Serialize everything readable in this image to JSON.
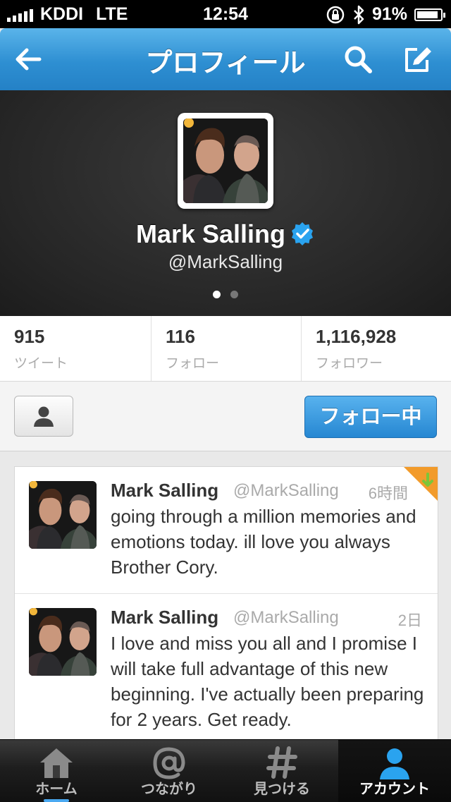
{
  "status_bar": {
    "carrier": "KDDI",
    "network": "LTE",
    "time": "12:54",
    "battery": "91%",
    "battery_level": 0.91
  },
  "navbar": {
    "title": "プロフィール",
    "back_icon": "back-arrow-icon",
    "search_icon": "search-icon",
    "compose_icon": "compose-icon"
  },
  "profile": {
    "name": "Mark Salling",
    "handle": "@MarkSalling",
    "verified": true,
    "page_count": 2,
    "current_page": 1
  },
  "stats": [
    {
      "value": "915",
      "label": "ツイート"
    },
    {
      "value": "116",
      "label": "フォロー"
    },
    {
      "value": "1,116,928",
      "label": "フォロワー"
    }
  ],
  "actions": {
    "follow_label": "フォロー中",
    "person_icon": "person-icon"
  },
  "tweets": [
    {
      "author": "Mark Salling",
      "username": "@MarkSalling",
      "time": "6時間",
      "text": "going through a million memories and emotions today. ill love you always Brother Cory."
    },
    {
      "author": "Mark Salling",
      "username": "@MarkSalling",
      "time": "2日",
      "text": "I love and miss you all and I promise I will take full advantage of this new beginning. I've actually been preparing for 2 years. Get ready."
    }
  ],
  "tabs": [
    {
      "label": "ホーム",
      "icon": "home-icon"
    },
    {
      "label": "つながり",
      "icon": "at-icon"
    },
    {
      "label": "見つける",
      "icon": "hashtag-icon"
    },
    {
      "label": "アカウント",
      "icon": "account-icon",
      "active": true
    }
  ],
  "colors": {
    "nav_blue": "#2e8fd2",
    "follow_blue": "#2687d2",
    "verified_blue": "#2aa3ef"
  }
}
